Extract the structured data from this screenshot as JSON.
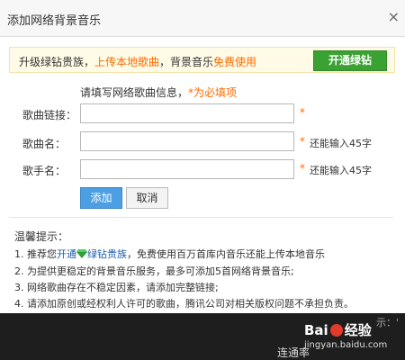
{
  "dialog": {
    "title": "添加网络背景音乐",
    "close": "×"
  },
  "promo": {
    "text_prefix": "升级绿钻贵族，",
    "link": "上传本地歌曲",
    "text_mid": "，背景音乐",
    "free": "免费使用",
    "button": "开通绿钻"
  },
  "form": {
    "hint_prefix": "请填写网络歌曲信息，",
    "hint_required": "*为必填项",
    "fields": [
      {
        "label": "歌曲链接：",
        "value": "",
        "required": "*",
        "limit": ""
      },
      {
        "label": "歌曲名：",
        "value": "",
        "required": "*",
        "limit": "还能输入45字"
      },
      {
        "label": "歌手名：",
        "value": "",
        "required": "*",
        "limit": "还能输入45字"
      }
    ],
    "add_button": "添加",
    "cancel_button": "取消"
  },
  "tips": {
    "title": "温馨提示：",
    "items": [
      {
        "prefix": "1. 推荐您",
        "link1": "开通",
        "link2": "绿钻贵族",
        "suffix": "，免费使用百万首库内音乐还能上传本地音乐"
      },
      {
        "text": "2. 为提供更稳定的背景音乐服务，最多可添加5首网络背景音乐;"
      },
      {
        "text": "3. 网络歌曲存在不稳定因素，请添加完整链接;"
      },
      {
        "text": "4. 请添加原创或经权利人许可的歌曲，腾讯公司对相关版权问题不承担负责。"
      }
    ]
  },
  "background": {
    "bottom_text": "连通率",
    "side_text": "示：'"
  },
  "watermark": {
    "logo_left": "Bai",
    "logo_right": "经验",
    "url": "jingyan.baidu.com"
  },
  "colors": {
    "accent_orange": "#ff6a00",
    "green_button": "#3aa233",
    "blue_button": "#4c9fe3",
    "link_blue": "#1a5cb3"
  }
}
